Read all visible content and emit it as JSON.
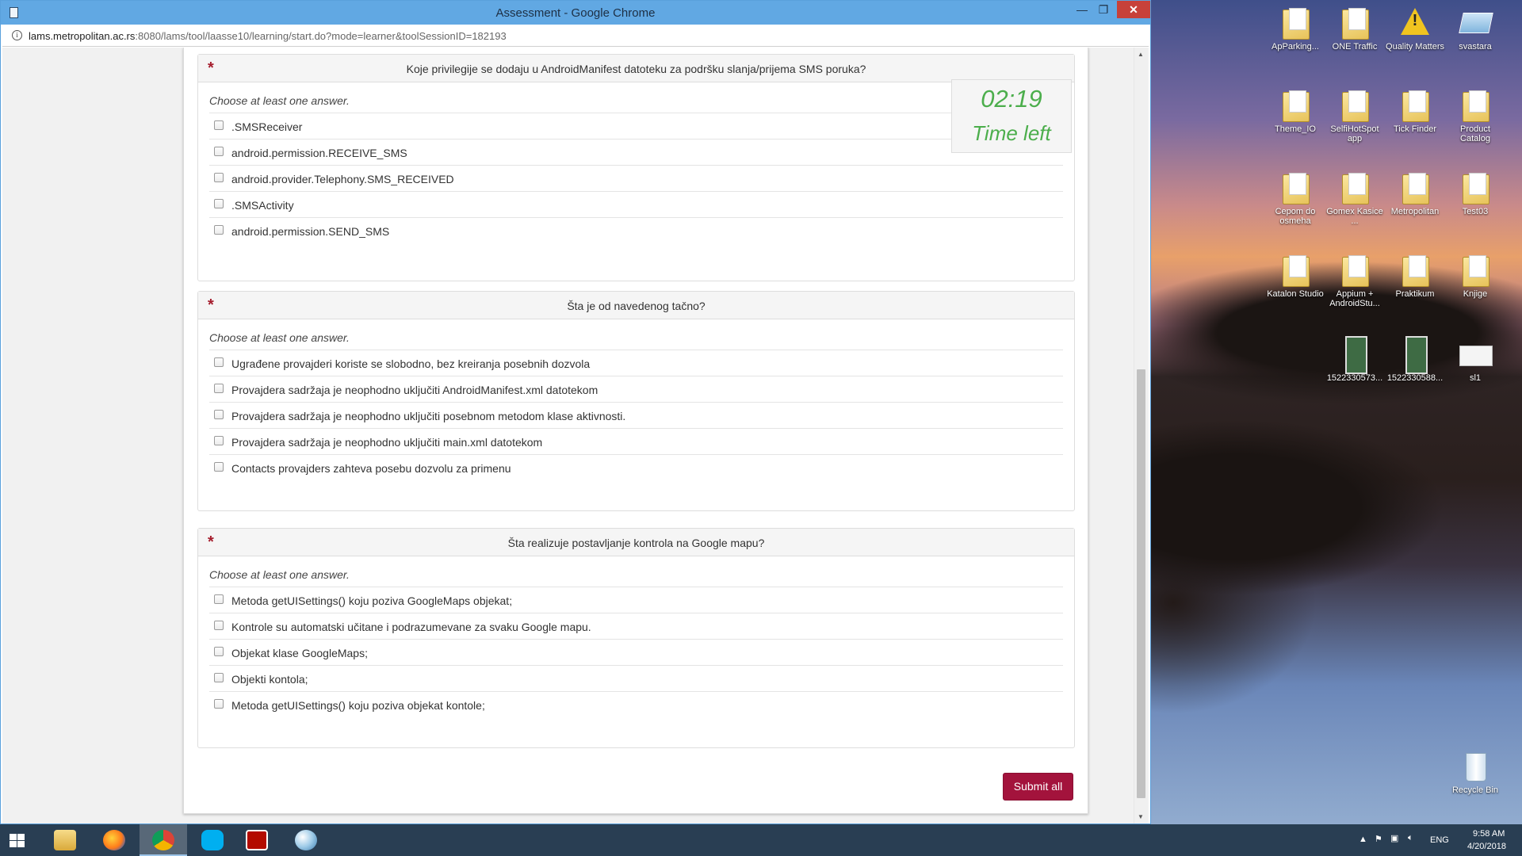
{
  "window": {
    "title": "Assessment - Google Chrome",
    "min_glyph": "—",
    "max_glyph": "❐",
    "close_glyph": "✕"
  },
  "address": {
    "url_host": "lams.metropolitan.ac.rs",
    "url_rest": ":8080/lams/tool/laasse10/learning/start.do?mode=learner&toolSessionID=182193"
  },
  "timer": {
    "time": "02:19",
    "label": "Time left"
  },
  "required_mark": "*",
  "questions": [
    {
      "text": "Koje privilegije se dodaju u AndroidManifest datoteku za podršku slanja/prijema SMS poruka?",
      "hint": "Choose at least one answer.",
      "answers": [
        ".SMSReceiver",
        "android.permission.RECEIVE_SMS",
        "android.provider.Telephony.SMS_RECEIVED",
        ".SMSActivity",
        "android.permission.SEND_SMS"
      ]
    },
    {
      "text": "Šta je od navedenog tačno?",
      "hint": "Choose at least one answer.",
      "answers": [
        "Ugrađene provajderi koriste se slobodno, bez kreiranja posebnih dozvola",
        "Provajdera sadržaja je neophodno uključiti AndroidManifest.xml datotekom",
        "Provajdera sadržaja je neophodno uključiti posebnom metodom klase aktivnosti.",
        "Provajdera sadržaja je neophodno uključiti main.xml datotekom",
        "Contacts provajders zahteva posebu dozvolu za primenu"
      ]
    },
    {
      "text": "Šta realizuje postavljanje kontrola na Google mapu?",
      "hint": "Choose at least one answer.",
      "answers": [
        "Metoda getUISettings() koju poziva GoogleMaps objekat;",
        "Kontrole su automatski učitane i podrazumevane za svaku Google mapu.",
        "Objekat klase GoogleMaps;",
        "Objekti kontola;",
        "Metoda getUISettings() koju poziva objekat kontole;"
      ]
    }
  ],
  "submit_label": "Submit all",
  "desktop_icons": [
    {
      "label": "ApParking...",
      "icon": "folder-icon"
    },
    {
      "label": "ONE Traffic",
      "icon": "folder-icon"
    },
    {
      "label": "Quality Matters",
      "icon": "warning-icon"
    },
    {
      "label": "svastara",
      "icon": "app-icon"
    },
    {
      "label": "Theme_IO",
      "icon": "folder-icon"
    },
    {
      "label": "SelfiHotSpot app",
      "icon": "folder-icon"
    },
    {
      "label": "Tick Finder",
      "icon": "folder-icon"
    },
    {
      "label": "Product Catalog",
      "icon": "folder-icon"
    },
    {
      "label": "Cepom do osmeha",
      "icon": "folder-icon"
    },
    {
      "label": "Gomex Kasice ...",
      "icon": "folder-icon"
    },
    {
      "label": "Metropolitan",
      "icon": "folder-icon"
    },
    {
      "label": "Test03",
      "icon": "folder-icon"
    },
    {
      "label": "Katalon Studio",
      "icon": "folder-icon"
    },
    {
      "label": "Appium + AndroidStu...",
      "icon": "folder-icon"
    },
    {
      "label": "Praktikum",
      "icon": "folder-icon"
    },
    {
      "label": "Knjige",
      "icon": "folder-icon"
    },
    {
      "label": "1522330573...",
      "icon": "image-file-icon"
    },
    {
      "label": "1522330588...",
      "icon": "image-file-icon"
    },
    {
      "label": "sl1",
      "icon": "image-file-icon"
    },
    {
      "label": "Recycle Bin",
      "icon": "recycle-bin-icon"
    }
  ],
  "taskbar": {
    "items": [
      "start",
      "file-explorer",
      "firefox",
      "chrome",
      "skype",
      "acrobat",
      "paint"
    ],
    "tray": {
      "language": "ENG",
      "time": "9:58 AM",
      "date": "4/20/2018"
    }
  },
  "colors": {
    "submit_bg": "#a3133c",
    "timer_text": "#4cae4c",
    "required_mark": "#a51d2d",
    "titlebar": "#61a8e3"
  }
}
